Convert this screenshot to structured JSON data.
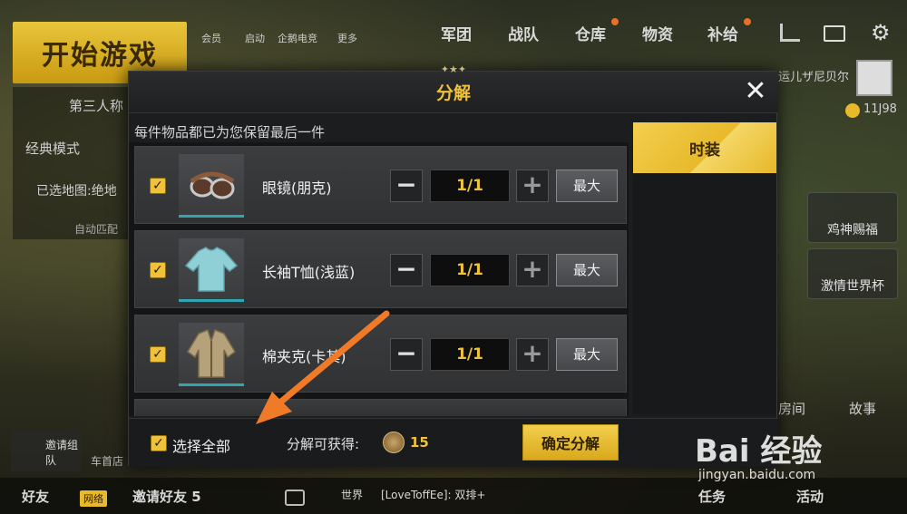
{
  "lobby": {
    "start_button": "开始游戏",
    "top_small": [
      "会员",
      "启动",
      "企鹅电竞",
      "更多"
    ],
    "nav_tabs": [
      "军团",
      "战队",
      "仓库",
      "物资",
      "补给"
    ],
    "mode_label": "第三人称",
    "classic_mode": "经典模式",
    "map_selected": "已选地图:绝地",
    "auto_match": "自动匹配",
    "player_name": "运儿ザ尼贝尔",
    "coins": "11J98",
    "right_cards": [
      "鸡神赐福",
      "激情世界杯"
    ],
    "right_lower": [
      "房间",
      "故事"
    ],
    "left_lower": [
      "邀请组队",
      "车首店"
    ],
    "bottom_bar": {
      "friends": "好友",
      "friends_badge": "网络",
      "invite": "邀请好友 5",
      "world_channel": "世界",
      "chat_text": "[LoveToffEe]: 双排+",
      "tasks": "任务",
      "events": "活动"
    }
  },
  "modal": {
    "title": "分解",
    "subtitle": "每件物品都已为您保留最后一件",
    "items": [
      {
        "name": "眼镜(朋克)",
        "qty": "1/1",
        "max_label": "最大",
        "icon": "goggles-icon",
        "checked": true
      },
      {
        "name": "长袖T恤(浅蓝)",
        "qty": "1/1",
        "max_label": "最大",
        "icon": "shirt-icon",
        "checked": true
      },
      {
        "name": "棉夹克(卡其)",
        "qty": "1/1",
        "max_label": "最大",
        "icon": "jacket-icon",
        "checked": true
      }
    ],
    "category_tab": "时装",
    "footer": {
      "select_all": "选择全部",
      "gain_label": "分解可获得:",
      "gain_amount": "15",
      "confirm": "确定分解"
    }
  },
  "watermark": {
    "logo": "Bai 经验",
    "url": "jingyan.baidu.com"
  },
  "colors": {
    "accent_gold": "#f0c23a",
    "annotation_arrow": "#f07a28",
    "teal_underline": "#2fa6b0"
  }
}
